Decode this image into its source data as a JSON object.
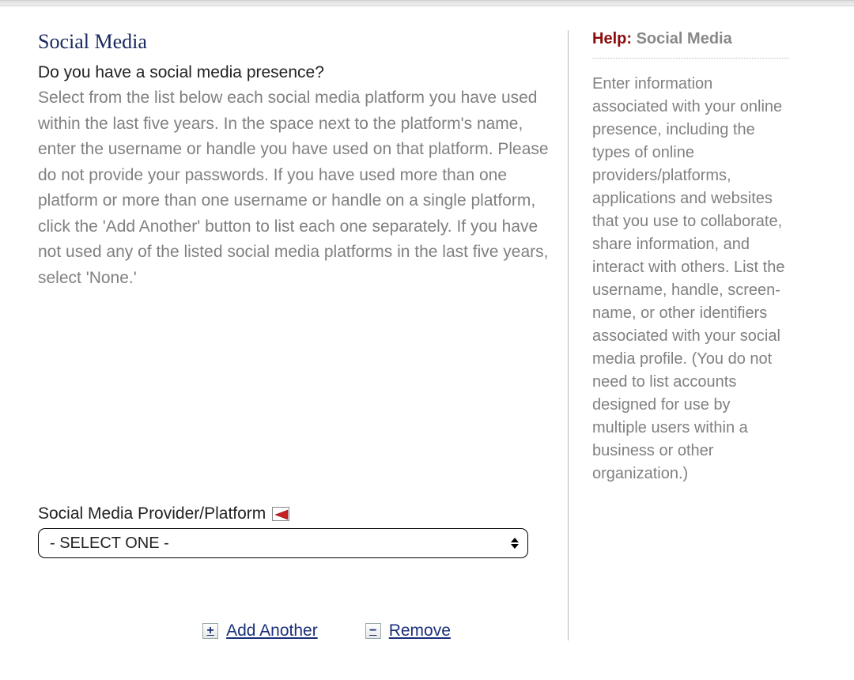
{
  "main": {
    "title": "Social Media",
    "question": "Do you have a social media presence?",
    "instructions": "Select from the list below each social media platform you have used within the last five years. In the space next to the platform's name, enter the username or handle you have used on that platform. Please do not provide your passwords. If you have used more than one platform or more than one username or handle on a single platform, click the 'Add Another' button to list each one separately. If you have not used any of the listed social media platforms in the last five years, select 'None.'",
    "field_label": "Social Media Provider/Platform",
    "select_value": "- SELECT ONE -",
    "add_label": "Add Another",
    "remove_label": "Remove"
  },
  "help": {
    "label": "Help:",
    "title": "Social Media",
    "body": "Enter information associated with your online presence, including the types of online providers/platforms, applications and websites that you use to collaborate, share information, and interact with others. List the username, handle, screen-name, or other identifiers associated with your social media profile. (You do not need to list accounts designed for use by multiple users within a business or other organization.)"
  }
}
